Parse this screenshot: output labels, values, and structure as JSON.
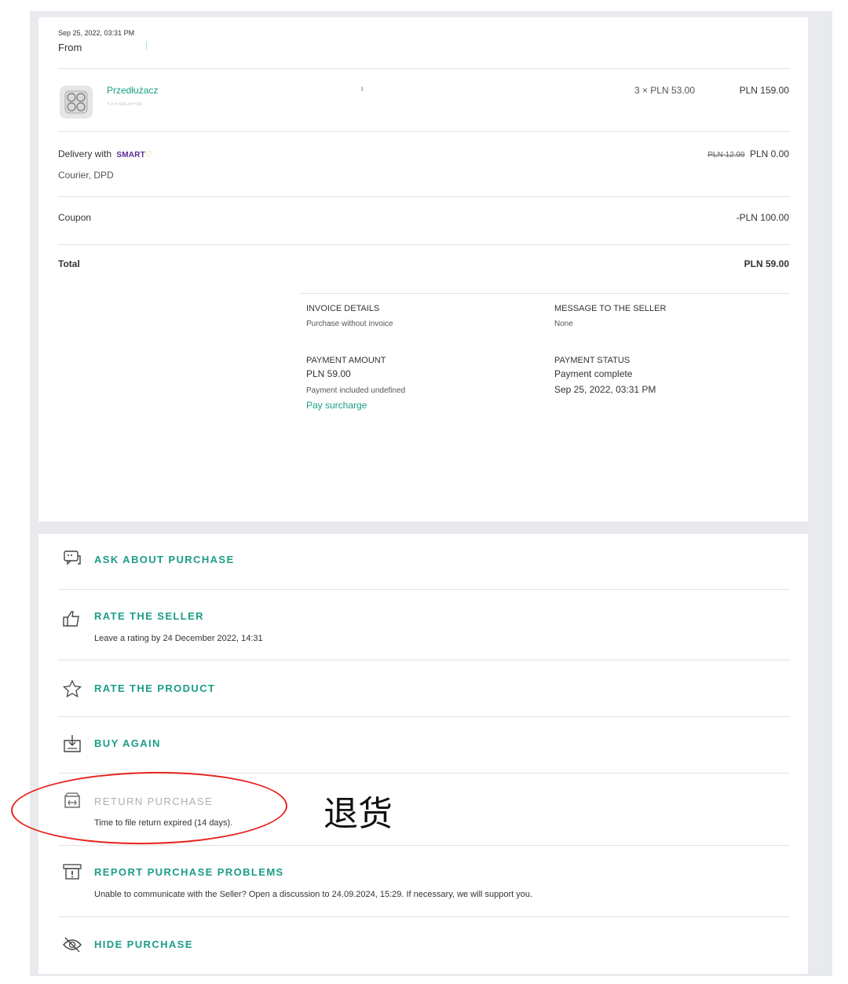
{
  "order": {
    "date": "Sep 25, 2022, 03:31 PM",
    "from_label": "From",
    "from_value": "|"
  },
  "product": {
    "name": "Przedłużacz",
    "sku": "101884028",
    "middle_mark": "ι",
    "qty_price": "3 × PLN 53.00",
    "total": "PLN 159.00",
    "icon": "power-strip-thumbnail"
  },
  "delivery": {
    "label": "Delivery with",
    "brand": "SMART",
    "brand_pin": "♡",
    "method": "Courier, DPD",
    "old_price": "PLN 12.99",
    "price": "PLN 0.00"
  },
  "coupon": {
    "label": "Coupon",
    "value": "-PLN 100.00"
  },
  "total": {
    "label": "Total",
    "value": "PLN 59.00"
  },
  "details": {
    "invoice_title": "INVOICE DETAILS",
    "invoice_value": "Purchase without invoice",
    "message_title": "MESSAGE TO THE SELLER",
    "message_value": "None",
    "amount_title": "PAYMENT AMOUNT",
    "amount_value": "PLN 59.00",
    "amount_note": "Payment included undefined",
    "pay_surcharge": "Pay surcharge",
    "status_title": "PAYMENT STATUS",
    "status_value": "Payment complete",
    "status_date": "Sep 25, 2022, 03:31 PM"
  },
  "actions": [
    {
      "title": "ASK ABOUT PURCHASE",
      "subtitle": "",
      "icon": "chat-icon",
      "enabled": true
    },
    {
      "title": "RATE THE SELLER",
      "subtitle": "Leave a rating by 24 December 2022, 14:31",
      "icon": "thumbs-up-icon",
      "enabled": true
    },
    {
      "title": "RATE THE PRODUCT",
      "subtitle": "",
      "icon": "star-icon",
      "enabled": true
    },
    {
      "title": "BUY AGAIN",
      "subtitle": "",
      "icon": "buy-again-icon",
      "enabled": true
    },
    {
      "title": "RETURN PURCHASE",
      "subtitle": "Time to file return expired (14 days).",
      "icon": "return-icon",
      "enabled": false
    },
    {
      "title": "REPORT PURCHASE PROBLEMS",
      "subtitle": "Unable to communicate with the Seller? Open a discussion to 24.09.2024, 15:29. If necessary, we will support you.",
      "icon": "report-icon",
      "enabled": true
    },
    {
      "title": "HIDE PURCHASE",
      "subtitle": "",
      "icon": "eye-off-icon",
      "enabled": true
    }
  ],
  "annotation": {
    "text": "退货",
    "color": "#e8231d"
  },
  "colors": {
    "accent": "#1a9e82",
    "disabled": "#a9b3b0",
    "background": "#e8eaed",
    "brand_smart": "#5a2d91"
  }
}
